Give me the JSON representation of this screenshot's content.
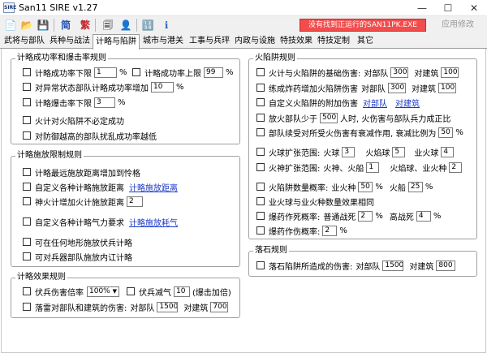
{
  "window": {
    "title": "San11 SIRE v1.27",
    "app_icon": "SIRE",
    "minimize": "—",
    "maximize": "☐",
    "close": "✕"
  },
  "toolbar": {
    "new_icon": "📄",
    "open_icon": "📂",
    "save_icon": "💾",
    "simplified": "简",
    "traditional": "繁",
    "tool1_icon": "🗐",
    "tool2_icon": "👤",
    "tool3_icon": "🔢",
    "tool4_icon": "ℹ",
    "status": "没有找到正运行的SAN11PK.EXE",
    "apply": "应用修改"
  },
  "tabs": [
    "武将与部队",
    "兵种与战法",
    "计略与陷阱",
    "城市与港关",
    "工事与兵玶",
    "内政与设施",
    "特技效果",
    "特技定制",
    "其它"
  ],
  "selected_tab": 2,
  "strat_rate": {
    "legend": "计略成功率和爆击率规则",
    "low_label": "计略成功率下限",
    "low_value": "1",
    "low_unit": "%",
    "high_label": "计略成功率上限",
    "high_value": "99",
    "high_unit": "%",
    "abnormal_label": "对异常状态部队计略成功率增加",
    "abnormal_value": "10",
    "abnormal_unit": "%",
    "crit_label": "计略爆击率下限",
    "crit_value": "3",
    "crit_unit": "%",
    "fire_label": "火计对火陷阱不必定成功",
    "chaos_label": "对防御越高的部队扰乱成功率越低"
  },
  "strat_limit": {
    "legend": "计略施放限制规则",
    "range_label": "计略最远施放距离增加到怜格",
    "custom_range_label": "自定义各种计略施放距离",
    "custom_range_link": "计略施放距离",
    "shenhuo_label": "神火计增加火计施放距离",
    "shenhuo_value": "2",
    "custom_cost_label": "自定义各种计略气力要求",
    "custom_cost_link": "计略施放耗气",
    "terrain_label": "可在任何地形施放伏兵计略",
    "weapon_label": "可对兵器部队施放内讧计略"
  },
  "strat_effect": {
    "legend": "计略效果规则",
    "ambush_label": "伏兵伤害倍率",
    "ambush_value": "100%",
    "ambush_arrow": "▼",
    "qi_label": "伏兵减气",
    "qi_value": "10",
    "qi_note": "(爆击加倍)",
    "thunder_label": "落雷对部队和建筑的伤害:",
    "thunder_troop_label": "对部队",
    "thunder_troop_value": "1500",
    "thunder_bldg_label": "对建筑",
    "thunder_bldg_value": "700"
  },
  "fire_trap": {
    "legend": "火陷阱规则",
    "base_label": "火计与火陷阱的基础伤害:",
    "base_troop_label": "对部队",
    "base_troop_value": "300",
    "base_bldg_label": "对建筑",
    "base_bldg_value": "100",
    "combo_label": "练成炸药增加火陷阱伤害",
    "combo_troop_label": "对部队",
    "combo_troop_value": "300",
    "combo_bldg_label": "对建筑",
    "combo_bldg_value": "100",
    "custom_label": "自定义火陷阱的附加伤害",
    "custom_link_troop": "对部队",
    "custom_link_bldg": "对建筑",
    "min_label": "放火部队少于",
    "min_value": "500",
    "min_suffix": "人时, 火伤害与部队兵力成正比",
    "resist_label": "部队续受对所受火伤害有衰减作用, 衰减比例为",
    "resist_value": "50",
    "resist_unit": "%",
    "spread_label": "火球扩张范围:",
    "fireball_label": "火球",
    "fireball_value": "3",
    "flame_label": "火焰球",
    "flame_value": "5",
    "fire_label": "业火球",
    "fire_value": "4",
    "god_spread_label": "火神扩张范围:",
    "god_ship_label": "火神、火船",
    "god_ship_value": "1",
    "flame_fire_label": "火焰球、业火种",
    "flame_fire_value": "2",
    "count_label": "火陷阱数量概率:",
    "count_fire_label": "业火种",
    "count_fire_value": "50",
    "count_ship_label": "火船",
    "count_ship_value": "25",
    "count_unit": "%",
    "same_label": "业火球与业火种数量效果相同",
    "die_label": "爆药作死概率:",
    "normal_label": "普通战死",
    "normal_value": "2",
    "normal_unit": "%",
    "high_label": "高战死",
    "high_value": "4",
    "high_unit": "%",
    "injury_label": "爆药作伤概率:",
    "injury_value": "2",
    "injury_unit": "%"
  },
  "rockfall": {
    "legend": "落石规则",
    "dmg_label": "落石陷阱所造成的伤害:",
    "troop_label": "对部队",
    "troop_value": "1500",
    "bldg_label": "对建筑",
    "bldg_value": "800"
  }
}
